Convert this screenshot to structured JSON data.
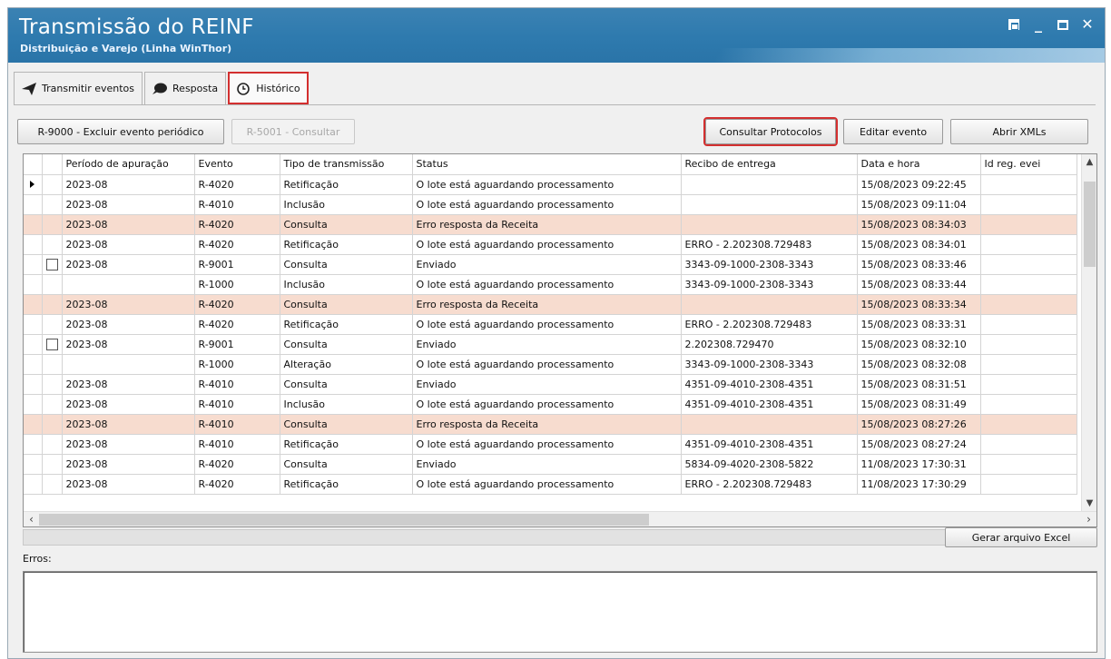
{
  "window": {
    "title": "Transmissão do REINF",
    "subtitle": "Distribuição e Varejo (Linha WinThor)"
  },
  "tabs": [
    {
      "label": "Transmitir eventos",
      "icon": "send-icon"
    },
    {
      "label": "Resposta",
      "icon": "speech-bubble-icon"
    },
    {
      "label": "Histórico",
      "icon": "clock-icon",
      "active": true
    }
  ],
  "toolbar": {
    "excluir_label": "R-9000 - Excluir evento periódico",
    "consultar_5001_label": "R-5001 - Consultar",
    "consultar_protocolos_label": "Consultar Protocolos",
    "editar_label": "Editar evento",
    "abrir_xml_label": "Abrir XMLs"
  },
  "grid": {
    "columns": [
      "Período de apuração",
      "Evento",
      "Tipo de transmissão",
      "Status",
      "Recibo de entrega",
      "Data e hora",
      "Id reg. evei"
    ],
    "rows": [
      {
        "periodo": "2023-08",
        "evento": "R-4020",
        "tipo": "Retificação",
        "status": "O lote está aguardando processamento",
        "recibo": "",
        "data": "15/08/2023 09:22:45",
        "current": true,
        "error": false,
        "checkbox": false
      },
      {
        "periodo": "2023-08",
        "evento": "R-4010",
        "tipo": "Inclusão",
        "status": "O lote está aguardando processamento",
        "recibo": "",
        "data": "15/08/2023 09:11:04",
        "error": false,
        "checkbox": false
      },
      {
        "periodo": "2023-08",
        "evento": "R-4020",
        "tipo": "Consulta",
        "status": "Erro resposta da Receita",
        "recibo": "",
        "data": "15/08/2023 08:34:03",
        "error": true,
        "checkbox": false
      },
      {
        "periodo": "2023-08",
        "evento": "R-4020",
        "tipo": "Retificação",
        "status": "O lote está aguardando processamento",
        "recibo": "ERRO - 2.202308.729483",
        "data": "15/08/2023 08:34:01",
        "error": false,
        "checkbox": false
      },
      {
        "periodo": "2023-08",
        "evento": "R-9001",
        "tipo": "Consulta",
        "status": "Enviado",
        "recibo": "3343-09-1000-2308-3343",
        "data": "15/08/2023 08:33:46",
        "error": false,
        "checkbox": true
      },
      {
        "periodo": "",
        "evento": "R-1000",
        "tipo": "Inclusão",
        "status": "O lote está aguardando processamento",
        "recibo": "3343-09-1000-2308-3343",
        "data": "15/08/2023 08:33:44",
        "error": false,
        "checkbox": false
      },
      {
        "periodo": "2023-08",
        "evento": "R-4020",
        "tipo": "Consulta",
        "status": "Erro resposta da Receita",
        "recibo": "",
        "data": "15/08/2023 08:33:34",
        "error": true,
        "checkbox": false
      },
      {
        "periodo": "2023-08",
        "evento": "R-4020",
        "tipo": "Retificação",
        "status": "O lote está aguardando processamento",
        "recibo": "ERRO - 2.202308.729483",
        "data": "15/08/2023 08:33:31",
        "error": false,
        "checkbox": false
      },
      {
        "periodo": "2023-08",
        "evento": "R-9001",
        "tipo": "Consulta",
        "status": "Enviado",
        "recibo": "2.202308.729470",
        "data": "15/08/2023 08:32:10",
        "error": false,
        "checkbox": true
      },
      {
        "periodo": "",
        "evento": "R-1000",
        "tipo": "Alteração",
        "status": "O lote está aguardando processamento",
        "recibo": "3343-09-1000-2308-3343",
        "data": "15/08/2023 08:32:08",
        "error": false,
        "checkbox": false
      },
      {
        "periodo": "2023-08",
        "evento": "R-4010",
        "tipo": "Consulta",
        "status": "Enviado",
        "recibo": "4351-09-4010-2308-4351",
        "data": "15/08/2023 08:31:51",
        "error": false,
        "checkbox": false
      },
      {
        "periodo": "2023-08",
        "evento": "R-4010",
        "tipo": "Inclusão",
        "status": "O lote está aguardando processamento",
        "recibo": "4351-09-4010-2308-4351",
        "data": "15/08/2023 08:31:49",
        "error": false,
        "checkbox": false
      },
      {
        "periodo": "2023-08",
        "evento": "R-4010",
        "tipo": "Consulta",
        "status": "Erro resposta da Receita",
        "recibo": "",
        "data": "15/08/2023 08:27:26",
        "error": true,
        "checkbox": false
      },
      {
        "periodo": "2023-08",
        "evento": "R-4010",
        "tipo": "Retificação",
        "status": "O lote está aguardando processamento",
        "recibo": "4351-09-4010-2308-4351",
        "data": "15/08/2023 08:27:24",
        "error": false,
        "checkbox": false
      },
      {
        "periodo": "2023-08",
        "evento": "R-4020",
        "tipo": "Consulta",
        "status": "Enviado",
        "recibo": "5834-09-4020-2308-5822",
        "data": "11/08/2023 17:30:31",
        "error": false,
        "checkbox": false
      },
      {
        "periodo": "2023-08",
        "evento": "R-4020",
        "tipo": "Retificação",
        "status": "O lote está aguardando processamento",
        "recibo": "ERRO - 2.202308.729483",
        "data": "11/08/2023 17:30:29",
        "error": false,
        "checkbox": false
      }
    ]
  },
  "footer": {
    "excel_label": "Gerar arquivo Excel",
    "erros_label": "Erros:",
    "erros_value": ""
  },
  "colors": {
    "title_bar": "#2e7aae",
    "error_row": "#f7dccf",
    "highlight_outline": "#d32f2f"
  }
}
